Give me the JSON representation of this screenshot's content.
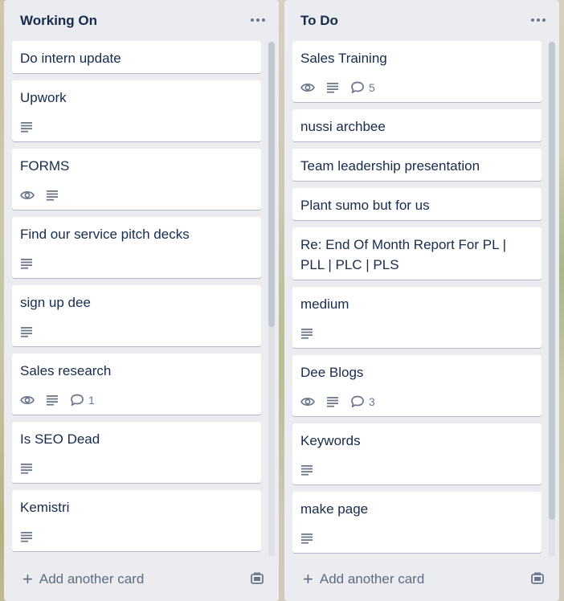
{
  "lists": [
    {
      "title": "Working On",
      "add_card_label": "Add another card",
      "cards": [
        {
          "title": "Do intern update",
          "badges": []
        },
        {
          "title": "Upwork",
          "badges": [
            "description"
          ]
        },
        {
          "title": "FORMS",
          "badges": [
            "watch",
            "description"
          ]
        },
        {
          "title": "Find our service pitch decks",
          "badges": [
            "description"
          ]
        },
        {
          "title": "sign up dee",
          "badges": [
            "description"
          ]
        },
        {
          "title": "Sales research",
          "badges": [
            "watch",
            "description",
            "comments"
          ],
          "comment_count": "1"
        },
        {
          "title": "Is SEO Dead",
          "badges": [
            "description"
          ]
        },
        {
          "title": "Kemistri",
          "badges": [
            "description"
          ]
        }
      ]
    },
    {
      "title": "To Do",
      "add_card_label": "Add another card",
      "cards": [
        {
          "title": "Sales Training",
          "badges": [
            "watch",
            "description",
            "comments"
          ],
          "comment_count": "5"
        },
        {
          "title": "nussi archbee",
          "badges": []
        },
        {
          "title": "Team leadership presentation",
          "badges": []
        },
        {
          "title": "Plant sumo but for us",
          "badges": []
        },
        {
          "title": "Re: End Of Month Report For PL | PLL | PLC | PLS",
          "badges": []
        },
        {
          "title": "medium",
          "badges": [
            "description"
          ]
        },
        {
          "title": "Dee Blogs",
          "badges": [
            "watch",
            "description",
            "comments"
          ],
          "comment_count": "3"
        },
        {
          "title": "Keywords",
          "badges": [
            "description"
          ]
        },
        {
          "title": "make page",
          "badges": [
            "description"
          ]
        }
      ]
    }
  ],
  "icons": {
    "watch": "eye-icon",
    "description": "description-icon",
    "comments": "comment-icon",
    "more": "more-horizontal-icon",
    "add": "plus-icon",
    "template": "card-template-icon"
  },
  "colors": {
    "list_bg": "#ebecf0",
    "card_bg": "#ffffff",
    "text": "#172b4d",
    "muted": "#6b778c"
  }
}
